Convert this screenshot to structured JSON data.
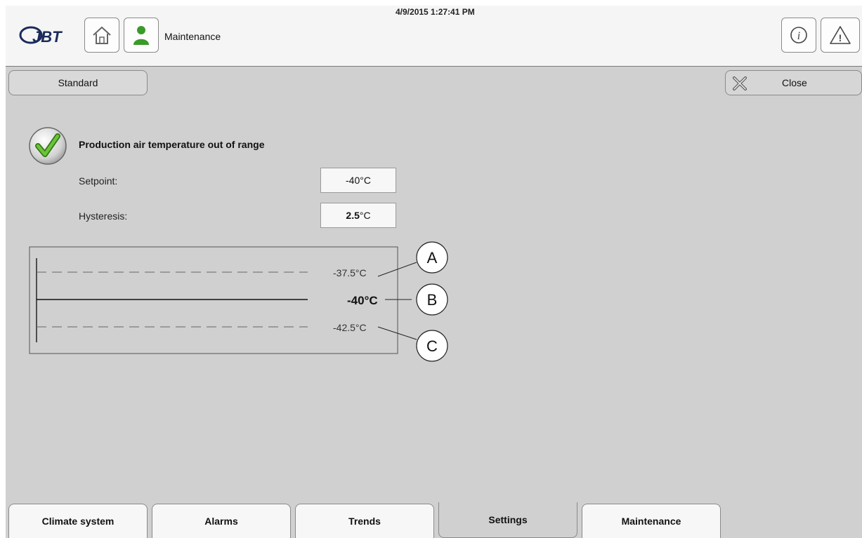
{
  "header": {
    "logo_text": "JBT",
    "user_label": "Maintenance",
    "datetime": "4/9/2015 1:27:41 PM",
    "icons": [
      "home-icon",
      "user-icon",
      "info-icon",
      "warning-icon"
    ]
  },
  "subbar": {
    "mode_tab": "Standard",
    "close_label": "Close"
  },
  "alarm": {
    "title": "Production air temperature out of range",
    "status_icon": "check-icon",
    "setpoint_label": "Setpoint:",
    "setpoint_value": "-40°C",
    "hysteresis_label": "Hysteresis:",
    "hysteresis_value": "2.5",
    "hysteresis_unit": "°C"
  },
  "diagram": {
    "upper_label": "-37.5°C",
    "setpoint_label": "-40°C",
    "lower_label": "-42.5°C",
    "callouts": [
      "A",
      "B",
      "C"
    ]
  },
  "tabs": [
    {
      "label": "Climate system",
      "active": false
    },
    {
      "label": "Alarms",
      "active": false
    },
    {
      "label": "Trends",
      "active": false
    },
    {
      "label": "Settings",
      "active": true
    },
    {
      "label": "Maintenance",
      "active": false
    }
  ],
  "colors": {
    "background": "#d0d0d0",
    "header": "#f5f5f5",
    "check_green": "#4aa523",
    "user_green": "#3a9a2a"
  }
}
